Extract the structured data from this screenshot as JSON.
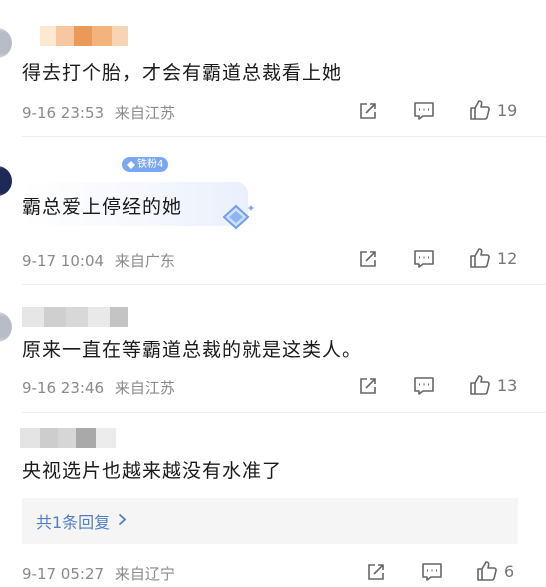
{
  "comments": [
    {
      "text": "得去打个胎，才会有霸道总裁看上她",
      "time": "9-16 23:53",
      "location": "来自江苏",
      "likes": "19"
    },
    {
      "badge": "铁粉4",
      "text": "霸总爱上停经的她",
      "time": "9-17 10:04",
      "location": "来自广东",
      "likes": "12"
    },
    {
      "text": "原来一直在等霸道总裁的就是这类人。",
      "time": "9-16 23:46",
      "location": "来自江苏",
      "likes": "13"
    },
    {
      "text": "央视选片也越来越没有水准了",
      "time": "9-17 05:27",
      "location": "来自辽宁",
      "likes": "6",
      "reply_summary": "共1条回复"
    }
  ],
  "icons": {
    "share": "share-icon",
    "comment": "comment-icon",
    "like": "thumbs-up-icon",
    "reply_arrow": "chevron-right-icon"
  },
  "colors": {
    "text": "#1a1a1a",
    "meta": "#8a8a8a",
    "link": "#4f7fc4",
    "badge": "#7aa8f0"
  }
}
